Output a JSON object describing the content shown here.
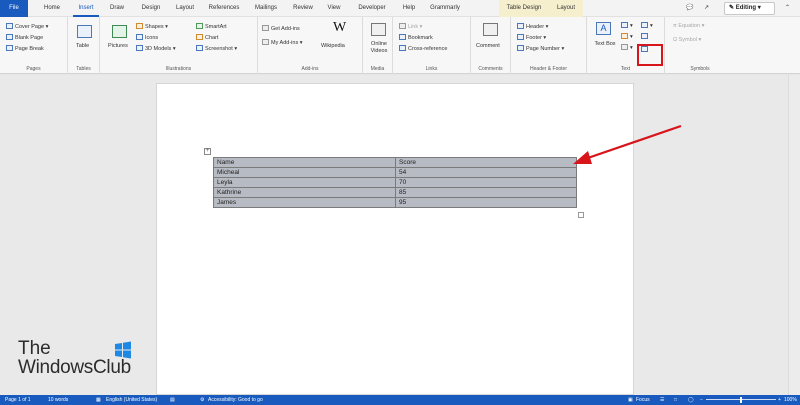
{
  "tabs": [
    "File",
    "Home",
    "Insert",
    "Draw",
    "Design",
    "Layout",
    "References",
    "Mailings",
    "Review",
    "View",
    "Developer",
    "Help",
    "Grammarly",
    "Table Design",
    "Layout"
  ],
  "active_tab": "Insert",
  "editing_label": "Editing",
  "ribbon": {
    "pages": {
      "label": "Pages",
      "items": [
        "Cover Page",
        "Blank Page",
        "Page Break"
      ]
    },
    "tables": {
      "label": "Tables",
      "table": "Table"
    },
    "illustrations": {
      "label": "Illustrations",
      "pictures": "Pictures",
      "shapes": "Shapes",
      "icons": "Icons",
      "models": "3D Models",
      "smartart": "SmartArt",
      "chart": "Chart",
      "screenshot": "Screenshot"
    },
    "addins": {
      "label": "Add-ins",
      "get": "Get Add-ins",
      "my": "My Add-ins",
      "wikipedia": "Wikipedia"
    },
    "media": {
      "label": "Media",
      "video": "Online Videos"
    },
    "links": {
      "label": "Links",
      "link": "Link",
      "bookmark": "Bookmark",
      "cross": "Cross-reference"
    },
    "comments": {
      "label": "Comments",
      "comment": "Comment"
    },
    "header_footer": {
      "label": "Header & Footer",
      "header": "Header",
      "footer": "Footer",
      "page_number": "Page Number"
    },
    "text": {
      "label": "Text",
      "textbox": "Text Box"
    },
    "symbols": {
      "label": "Symbols",
      "equation": "Equation",
      "symbol": "Symbol"
    }
  },
  "document_table": {
    "header": [
      "Name",
      "Score"
    ],
    "rows": [
      [
        "Micheal",
        "54"
      ],
      [
        "Leyla",
        "70"
      ],
      [
        "Kathrine",
        "85"
      ],
      [
        "James",
        "95"
      ]
    ]
  },
  "watermark": {
    "line1": "The",
    "line2": "WindowsClub"
  },
  "status_bar": {
    "page": "Page 1 of 1",
    "words": "10 words",
    "language": "English (United States)",
    "accessibility": "Accessibility: Good to go",
    "focus": "Focus",
    "zoom": "100%"
  },
  "colors": {
    "accent": "#185abd",
    "highlight": "#d8151b",
    "table_fill": "#b7bbc3"
  }
}
